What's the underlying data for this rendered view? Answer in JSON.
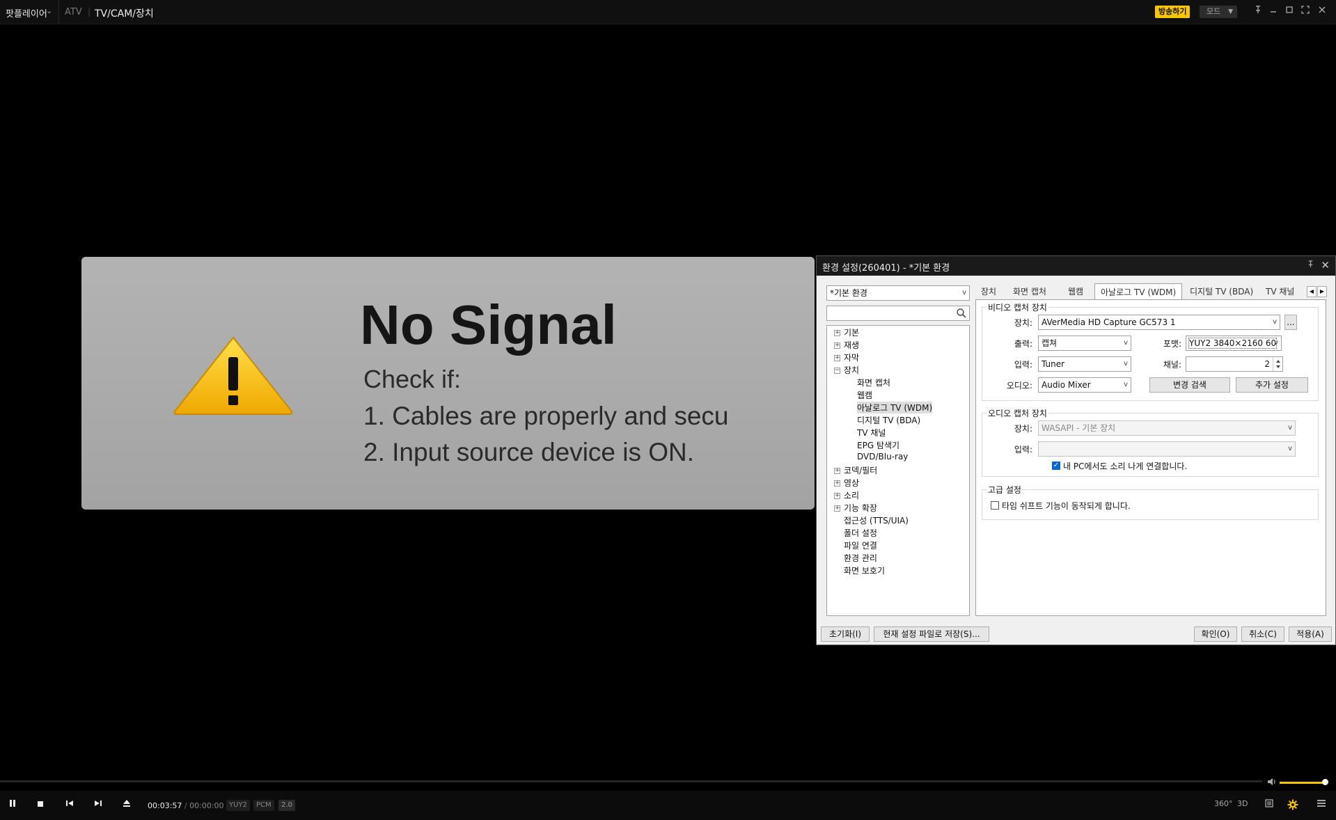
{
  "titlebar": {
    "app_name": "팟플레이어",
    "breadcrumb1": "ATV",
    "breadcrumb2": "TV/CAM/장치",
    "broadcast_label": "방송하기",
    "mode_label": "모드"
  },
  "video": {
    "title": "No Signal",
    "check": "Check if:",
    "line1": "1. Cables are properly and secu",
    "line2": "2. Input source device is ON."
  },
  "dialog": {
    "title": "환경 설정(260401) - *기본 환경",
    "preset": "*기본 환경",
    "tree": {
      "basic": "기본",
      "playback": "재생",
      "subtitle": "자막",
      "device": "장치",
      "screen_capture": "화면 캡처",
      "webcam": "웹캠",
      "analog_tv": "아날로그 TV (WDM)",
      "digital_tv": "디지털 TV (BDA)",
      "tv_channel": "TV 채널",
      "epg": "EPG 탐색기",
      "dvd": "DVD/Blu-ray",
      "codec": "코덱/필터",
      "video": "영상",
      "sound": "소리",
      "extension": "기능 확장",
      "accessibility": "접근성 (TTS/UIA)",
      "folder": "폴더 설정",
      "file_assoc": "파일 연결",
      "config_mgmt": "환경 관리",
      "screensaver": "화면 보호기"
    },
    "tabs": {
      "device": "장치",
      "screen_capture": "화면 캡처",
      "webcam": "웹캠",
      "analog": "아날로그 TV (WDM)",
      "digital": "디지털 TV (BDA)",
      "tv_channel": "TV 채널"
    },
    "video_group": {
      "legend": "비디오 캡처 장치",
      "device_label": "장치:",
      "device_value": "AVerMedia HD Capture GC573 1",
      "more_label": "...",
      "output_label": "출력:",
      "output_value": "캡쳐",
      "format_label": "포맷:",
      "format_value": "YUY2 3840×2160 60",
      "input_label": "입력:",
      "input_value": "Tuner",
      "channel_label": "채널:",
      "channel_value": "2",
      "audio_label": "오디오:",
      "audio_value": "Audio Mixer",
      "change_search": "변경 검색",
      "extra_settings": "추가 설정"
    },
    "audio_group": {
      "legend": "오디오 캡처 장치",
      "device_label": "장치:",
      "device_value": "WASAPI - 기본 장치",
      "input_label": "입력:",
      "input_value": "",
      "pc_sound": "내 PC에서도 소리 나게 연결합니다."
    },
    "advanced_group": {
      "legend": "고급 설정",
      "timeshift": "타임 쉬프트 기능이 동작되게 합니다."
    },
    "buttons": {
      "reset": "초기화(I)",
      "save_file": "현재 설정 파일로 저장(S)...",
      "ok": "확인(O)",
      "cancel": "취소(C)",
      "apply": "적용(A)"
    }
  },
  "player": {
    "current_time": "00:03:57",
    "separator": "/",
    "total_time": "00:00:00",
    "badges": [
      "YUY2",
      "PCM",
      "2.0"
    ],
    "vr_label": "360°",
    "three_d_label": "3D",
    "volume": 0.95
  },
  "colors": {
    "accent": "#f7c600",
    "background": "#000000",
    "dialog_bg": "#f0f0f0"
  }
}
